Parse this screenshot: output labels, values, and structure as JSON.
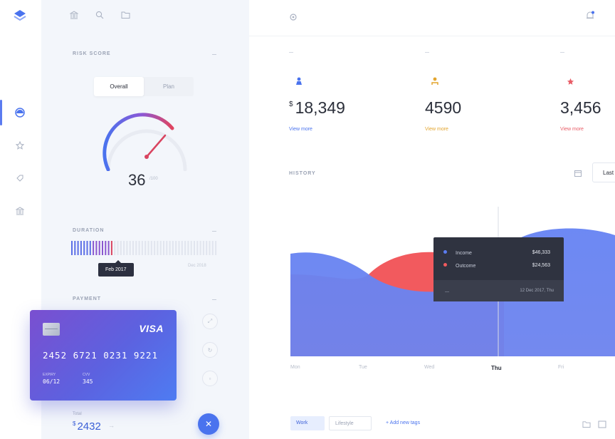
{
  "left_rail": {
    "logo_icon": "layers-icon",
    "items": [
      "gauge-icon",
      "star-icon",
      "tag-icon",
      "bank-icon"
    ]
  },
  "panel": {
    "top_icons": [
      "bank-icon",
      "search-icon",
      "folder-icon"
    ],
    "risk_score": {
      "label": "Risk score",
      "toggle": [
        "Overall",
        "Plan"
      ],
      "selected": "Overall",
      "gauge_value": "36",
      "gauge_unit": "/100",
      "gauge_fraction": 0.36
    },
    "duration": {
      "label": "Duration",
      "tooltip": "Feb 2017",
      "end_label": "Dec 2018",
      "filled_fraction": 0.3
    },
    "payment": {
      "label": "Payment",
      "card": {
        "brand": "VISA",
        "number": "2452 6721 0231 9221",
        "expiry_label": "Expiry",
        "expiry": "06/12",
        "cvv_label": "CVV",
        "cvv": "345"
      },
      "actions": [
        "expand-icon",
        "refresh-icon",
        "trash-icon"
      ],
      "total_label": "Total",
      "currency": "$",
      "total": "2432",
      "fab_icon": "close-icon"
    }
  },
  "main": {
    "top_left_icon": "gear-icon",
    "top_right_icon": "bell-icon",
    "stats": [
      {
        "icon": "user-icon",
        "currency": "$",
        "value": "18,349",
        "link": "View more",
        "color": "#4a73ee",
        "bg": "#e8eefd"
      },
      {
        "icon": "person-icon",
        "currency": "",
        "value": "4590",
        "link": "View more",
        "color": "#e3a52f",
        "bg": "#fdf1dc"
      },
      {
        "icon": "star-icon",
        "currency": "",
        "value": "3,456",
        "link": "View more",
        "color": "#e85c66",
        "bg": "#fde7e8"
      }
    ],
    "history": {
      "label": "History",
      "range_button": "Last",
      "days": [
        "Mon",
        "Tue",
        "Wed",
        "Thu",
        "Fri"
      ],
      "selected_day": "Thu",
      "tooltip": {
        "income_label": "Income",
        "income_value": "$46,333",
        "outcome_label": "Outcome",
        "outcome_value": "$24,563",
        "footer_dash": "—",
        "date": "12 Dec 2017, Thu"
      },
      "colors": {
        "income": "#5a7cf0",
        "outcome": "#f25a5e"
      }
    },
    "tags": [
      "Work",
      "Lifestyle"
    ],
    "add_tags": "+ Add new tags",
    "bottom_icons": [
      "folder-icon",
      "image-icon"
    ]
  }
}
